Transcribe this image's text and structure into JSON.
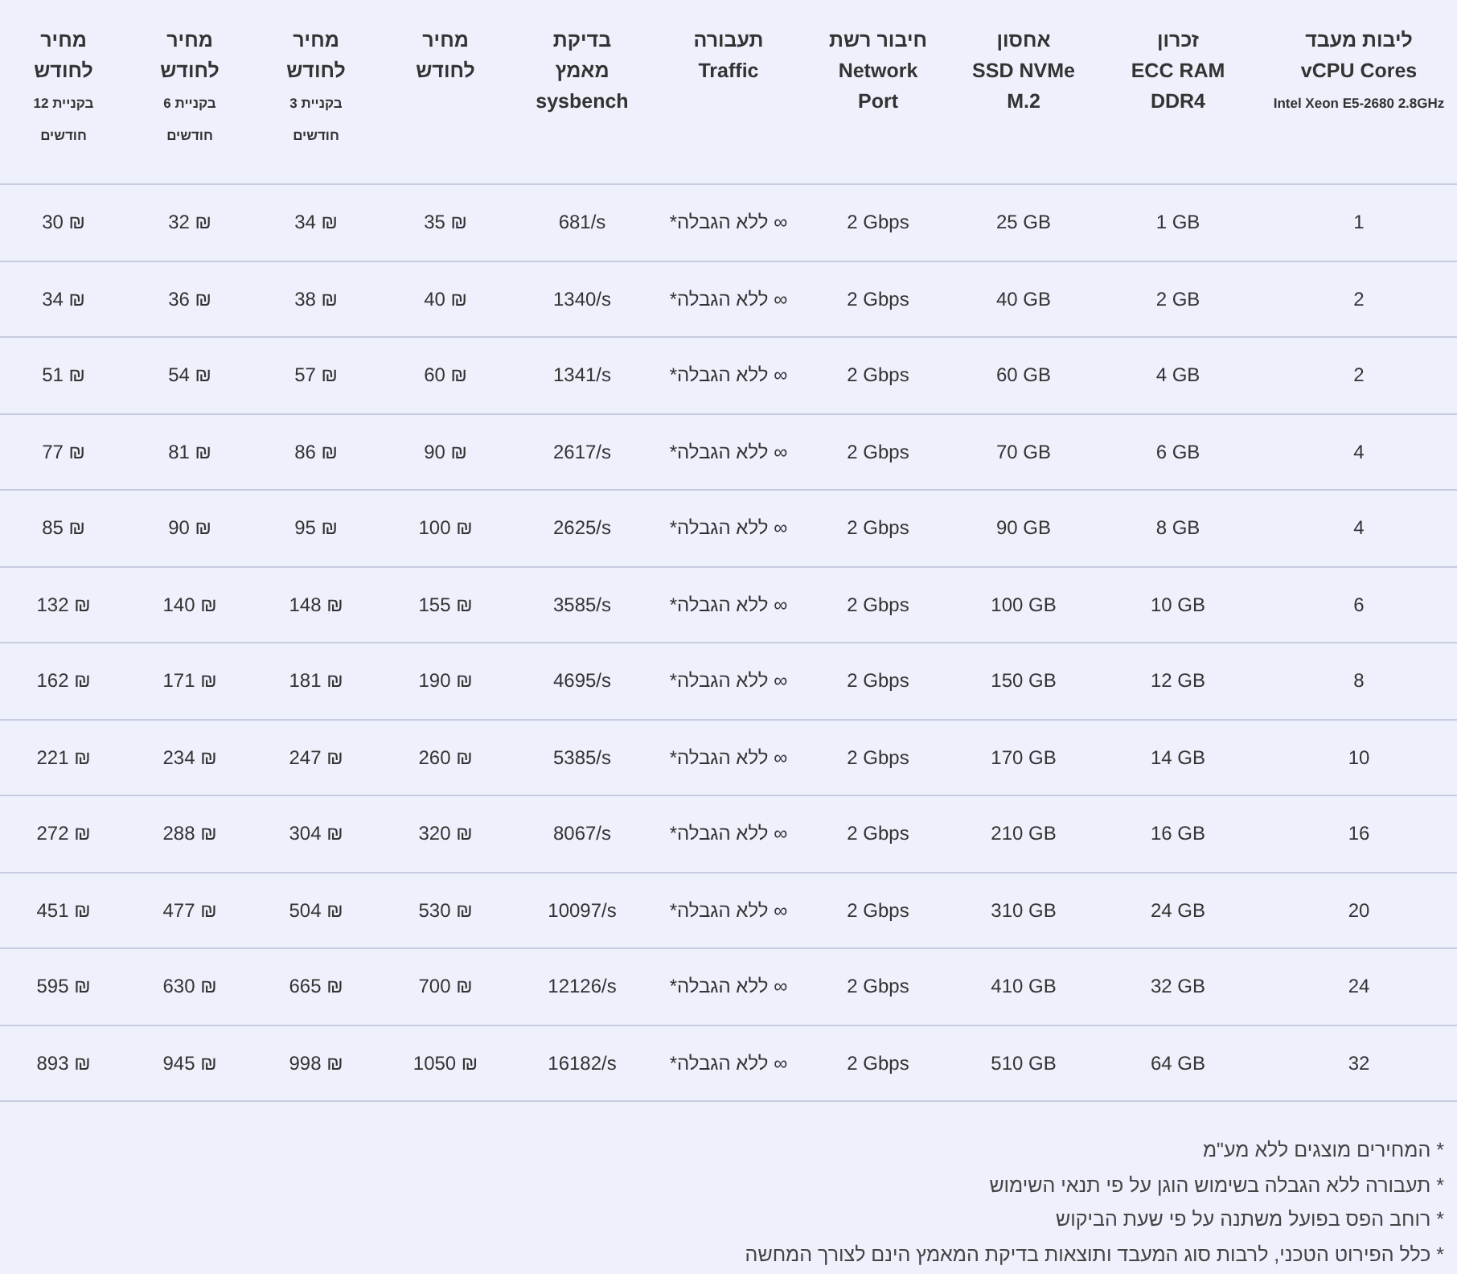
{
  "table": {
    "columns": [
      {
        "lines": [
          "מחיר",
          "לחודש"
        ],
        "sub": [
          "בקניית 12",
          "חודשים"
        ]
      },
      {
        "lines": [
          "מחיר",
          "לחודש"
        ],
        "sub": [
          "בקניית 6",
          "חודשים"
        ]
      },
      {
        "lines": [
          "מחיר",
          "לחודש"
        ],
        "sub": [
          "בקניית 3",
          "חודשים"
        ]
      },
      {
        "lines": [
          "מחיר",
          "לחודש"
        ]
      },
      {
        "lines": [
          "בדיקת",
          "מאמץ",
          "sysbench"
        ]
      },
      {
        "lines": [
          "תעבורה",
          "Traffic"
        ],
        "kind": "rtl"
      },
      {
        "lines": [
          "חיבור רשת",
          "Network",
          "Port"
        ]
      },
      {
        "lines": [
          "אחסון",
          "SSD NVMe",
          "M.2"
        ]
      },
      {
        "lines": [
          "זכרון",
          "ECC RAM",
          "DDR4"
        ]
      },
      {
        "lines": [
          "ליבות מעבד",
          "vCPU Cores"
        ],
        "sub": [
          "Intel Xeon E5-2680 2.8GHz"
        ]
      }
    ],
    "rows": [
      [
        "30 ₪",
        "32 ₪",
        "34 ₪",
        "35 ₪",
        "681/s",
        "∞ ללא הגבלה*",
        "2 Gbps",
        "25 GB",
        "1 GB",
        "1"
      ],
      [
        "34 ₪",
        "36 ₪",
        "38 ₪",
        "40 ₪",
        "1340/s",
        "∞ ללא הגבלה*",
        "2 Gbps",
        "40 GB",
        "2 GB",
        "2"
      ],
      [
        "51 ₪",
        "54 ₪",
        "57 ₪",
        "60 ₪",
        "1341/s",
        "∞ ללא הגבלה*",
        "2 Gbps",
        "60 GB",
        "4 GB",
        "2"
      ],
      [
        "77 ₪",
        "81 ₪",
        "86 ₪",
        "90 ₪",
        "2617/s",
        "∞ ללא הגבלה*",
        "2 Gbps",
        "70 GB",
        "6 GB",
        "4"
      ],
      [
        "85 ₪",
        "90 ₪",
        "95 ₪",
        "100 ₪",
        "2625/s",
        "∞ ללא הגבלה*",
        "2 Gbps",
        "90 GB",
        "8 GB",
        "4"
      ],
      [
        "132 ₪",
        "140 ₪",
        "148 ₪",
        "155 ₪",
        "3585/s",
        "∞ ללא הגבלה*",
        "2 Gbps",
        "100 GB",
        "10 GB",
        "6"
      ],
      [
        "162 ₪",
        "171 ₪",
        "181 ₪",
        "190 ₪",
        "4695/s",
        "∞ ללא הגבלה*",
        "2 Gbps",
        "150 GB",
        "12 GB",
        "8"
      ],
      [
        "221 ₪",
        "234 ₪",
        "247 ₪",
        "260 ₪",
        "5385/s",
        "∞ ללא הגבלה*",
        "2 Gbps",
        "170 GB",
        "14 GB",
        "10"
      ],
      [
        "272 ₪",
        "288 ₪",
        "304 ₪",
        "320 ₪",
        "8067/s",
        "∞ ללא הגבלה*",
        "2 Gbps",
        "210 GB",
        "16 GB",
        "16"
      ],
      [
        "451 ₪",
        "477 ₪",
        "504 ₪",
        "530 ₪",
        "10097/s",
        "∞ ללא הגבלה*",
        "2 Gbps",
        "310 GB",
        "24 GB",
        "20"
      ],
      [
        "595 ₪",
        "630 ₪",
        "665 ₪",
        "700 ₪",
        "12126/s",
        "∞ ללא הגבלה*",
        "2 Gbps",
        "410 GB",
        "32 GB",
        "24"
      ],
      [
        "893 ₪",
        "945 ₪",
        "998 ₪",
        "1050 ₪",
        "16182/s",
        "∞ ללא הגבלה*",
        "2 Gbps",
        "510 GB",
        "64 GB",
        "32"
      ]
    ]
  },
  "notes": [
    "* המחירים מוצגים ללא מע\"מ",
    "* תעבורה ללא הגבלה בשימוש הוגן על פי תנאי השימוש",
    "* רוחב הפס בפועל משתנה על פי שעת הביקוש",
    "* כלל הפירוט הטכני, לרבות סוג המעבד ותוצאות בדיקת המאמץ הינם לצורך המחשה"
  ]
}
